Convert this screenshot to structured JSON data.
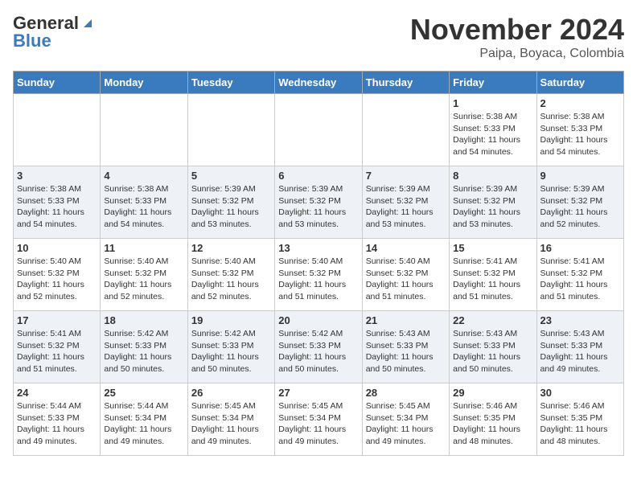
{
  "header": {
    "logo_general": "General",
    "logo_blue": "Blue",
    "month_title": "November 2024",
    "location": "Paipa, Boyaca, Colombia"
  },
  "days_of_week": [
    "Sunday",
    "Monday",
    "Tuesday",
    "Wednesday",
    "Thursday",
    "Friday",
    "Saturday"
  ],
  "weeks": [
    [
      {
        "day": "",
        "info": ""
      },
      {
        "day": "",
        "info": ""
      },
      {
        "day": "",
        "info": ""
      },
      {
        "day": "",
        "info": ""
      },
      {
        "day": "",
        "info": ""
      },
      {
        "day": "1",
        "info": "Sunrise: 5:38 AM\nSunset: 5:33 PM\nDaylight: 11 hours and 54 minutes."
      },
      {
        "day": "2",
        "info": "Sunrise: 5:38 AM\nSunset: 5:33 PM\nDaylight: 11 hours and 54 minutes."
      }
    ],
    [
      {
        "day": "3",
        "info": "Sunrise: 5:38 AM\nSunset: 5:33 PM\nDaylight: 11 hours and 54 minutes."
      },
      {
        "day": "4",
        "info": "Sunrise: 5:38 AM\nSunset: 5:33 PM\nDaylight: 11 hours and 54 minutes."
      },
      {
        "day": "5",
        "info": "Sunrise: 5:39 AM\nSunset: 5:32 PM\nDaylight: 11 hours and 53 minutes."
      },
      {
        "day": "6",
        "info": "Sunrise: 5:39 AM\nSunset: 5:32 PM\nDaylight: 11 hours and 53 minutes."
      },
      {
        "day": "7",
        "info": "Sunrise: 5:39 AM\nSunset: 5:32 PM\nDaylight: 11 hours and 53 minutes."
      },
      {
        "day": "8",
        "info": "Sunrise: 5:39 AM\nSunset: 5:32 PM\nDaylight: 11 hours and 53 minutes."
      },
      {
        "day": "9",
        "info": "Sunrise: 5:39 AM\nSunset: 5:32 PM\nDaylight: 11 hours and 52 minutes."
      }
    ],
    [
      {
        "day": "10",
        "info": "Sunrise: 5:40 AM\nSunset: 5:32 PM\nDaylight: 11 hours and 52 minutes."
      },
      {
        "day": "11",
        "info": "Sunrise: 5:40 AM\nSunset: 5:32 PM\nDaylight: 11 hours and 52 minutes."
      },
      {
        "day": "12",
        "info": "Sunrise: 5:40 AM\nSunset: 5:32 PM\nDaylight: 11 hours and 52 minutes."
      },
      {
        "day": "13",
        "info": "Sunrise: 5:40 AM\nSunset: 5:32 PM\nDaylight: 11 hours and 51 minutes."
      },
      {
        "day": "14",
        "info": "Sunrise: 5:40 AM\nSunset: 5:32 PM\nDaylight: 11 hours and 51 minutes."
      },
      {
        "day": "15",
        "info": "Sunrise: 5:41 AM\nSunset: 5:32 PM\nDaylight: 11 hours and 51 minutes."
      },
      {
        "day": "16",
        "info": "Sunrise: 5:41 AM\nSunset: 5:32 PM\nDaylight: 11 hours and 51 minutes."
      }
    ],
    [
      {
        "day": "17",
        "info": "Sunrise: 5:41 AM\nSunset: 5:32 PM\nDaylight: 11 hours and 51 minutes."
      },
      {
        "day": "18",
        "info": "Sunrise: 5:42 AM\nSunset: 5:33 PM\nDaylight: 11 hours and 50 minutes."
      },
      {
        "day": "19",
        "info": "Sunrise: 5:42 AM\nSunset: 5:33 PM\nDaylight: 11 hours and 50 minutes."
      },
      {
        "day": "20",
        "info": "Sunrise: 5:42 AM\nSunset: 5:33 PM\nDaylight: 11 hours and 50 minutes."
      },
      {
        "day": "21",
        "info": "Sunrise: 5:43 AM\nSunset: 5:33 PM\nDaylight: 11 hours and 50 minutes."
      },
      {
        "day": "22",
        "info": "Sunrise: 5:43 AM\nSunset: 5:33 PM\nDaylight: 11 hours and 50 minutes."
      },
      {
        "day": "23",
        "info": "Sunrise: 5:43 AM\nSunset: 5:33 PM\nDaylight: 11 hours and 49 minutes."
      }
    ],
    [
      {
        "day": "24",
        "info": "Sunrise: 5:44 AM\nSunset: 5:33 PM\nDaylight: 11 hours and 49 minutes."
      },
      {
        "day": "25",
        "info": "Sunrise: 5:44 AM\nSunset: 5:34 PM\nDaylight: 11 hours and 49 minutes."
      },
      {
        "day": "26",
        "info": "Sunrise: 5:45 AM\nSunset: 5:34 PM\nDaylight: 11 hours and 49 minutes."
      },
      {
        "day": "27",
        "info": "Sunrise: 5:45 AM\nSunset: 5:34 PM\nDaylight: 11 hours and 49 minutes."
      },
      {
        "day": "28",
        "info": "Sunrise: 5:45 AM\nSunset: 5:34 PM\nDaylight: 11 hours and 49 minutes."
      },
      {
        "day": "29",
        "info": "Sunrise: 5:46 AM\nSunset: 5:35 PM\nDaylight: 11 hours and 48 minutes."
      },
      {
        "day": "30",
        "info": "Sunrise: 5:46 AM\nSunset: 5:35 PM\nDaylight: 11 hours and 48 minutes."
      }
    ]
  ]
}
